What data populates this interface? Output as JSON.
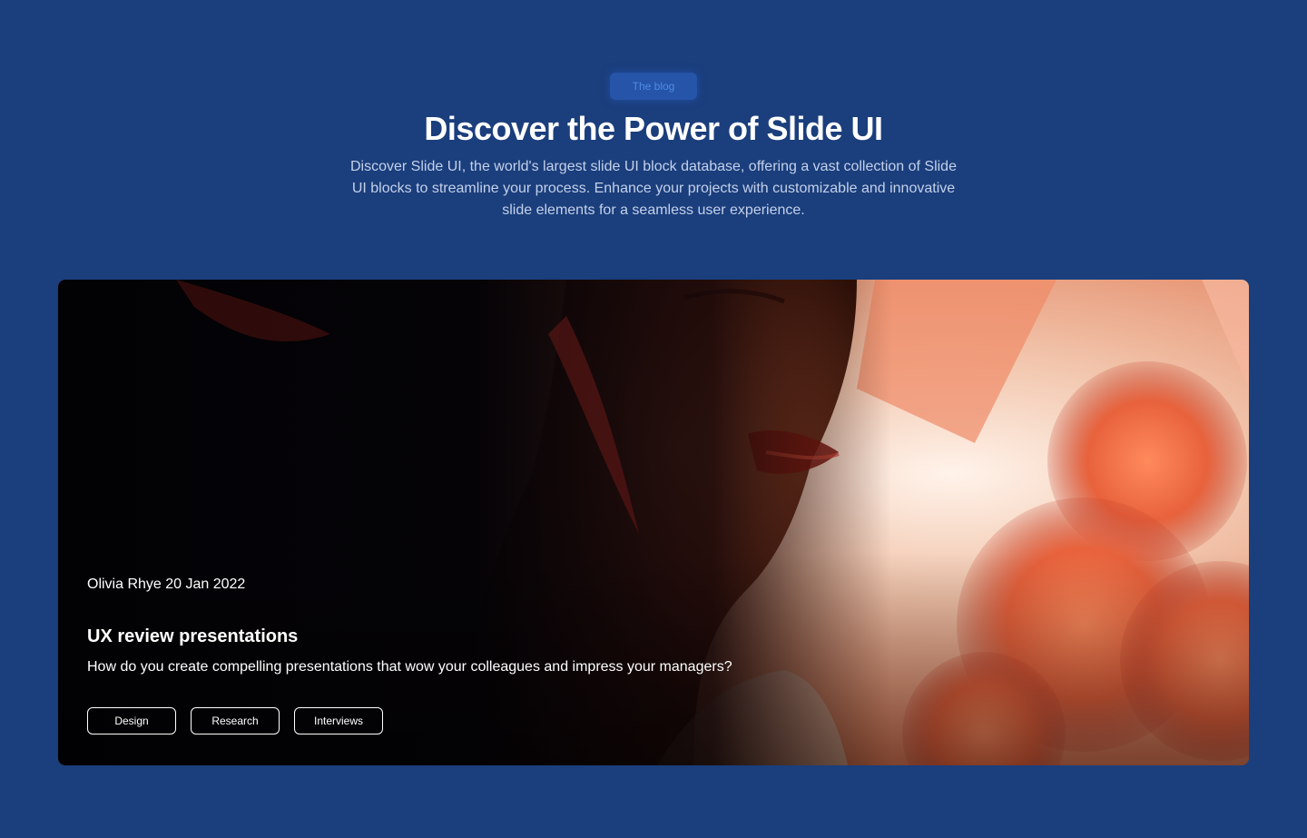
{
  "header": {
    "badge": "The blog",
    "title": "Discover the Power of Slide UI",
    "subtitle": "Discover Slide UI, the world's largest slide UI block database, offering a vast collection of Slide UI blocks to streamline your process. Enhance your projects with customizable and innovative slide elements for a seamless user experience."
  },
  "post": {
    "meta": "Olivia Rhye 20 Jan 2022",
    "title": "UX review presentations",
    "description": "How do you create compelling presentations that wow your colleagues and impress your managers?",
    "tags": [
      "Design",
      "Research",
      "Interviews"
    ]
  },
  "colors": {
    "background": "#1b3e7c",
    "badge_bg": "#2554a8",
    "badge_text": "#4f8be6",
    "subtitle": "#c3d1ea",
    "accent_coral": "#e8623c"
  }
}
